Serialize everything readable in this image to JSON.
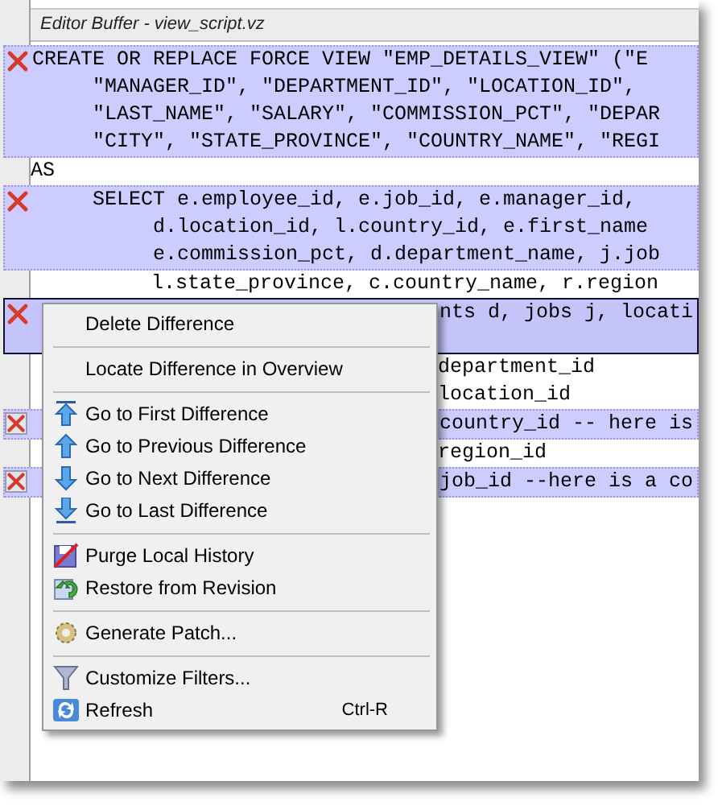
{
  "panel": {
    "title": "Editor Buffer - view_script.vz"
  },
  "blocks": [
    {
      "kind": "diff",
      "selected": false,
      "lines": [
        {
          "text": "CREATE OR REPLACE FORCE VIEW \"EMP_DETAILS_VIEW\" (\"E",
          "covered": false
        },
        {
          "text": "     \"MANAGER_ID\", \"DEPARTMENT_ID\", \"LOCATION_ID\",",
          "covered": false
        },
        {
          "text": "     \"LAST_NAME\", \"SALARY\", \"COMMISSION_PCT\", \"DEPAR",
          "covered": false
        },
        {
          "text": "     \"CITY\", \"STATE_PROVINCE\", \"COUNTRY_NAME\", \"REGI",
          "covered": false
        }
      ]
    },
    {
      "kind": "plain",
      "lines": [
        {
          "text": "AS",
          "covered": false
        }
      ]
    },
    {
      "kind": "diff",
      "selected": false,
      "lines": [
        {
          "text": "     SELECT e.employee_id, e.job_id, e.manager_id,",
          "covered": false
        },
        {
          "text": "          d.location_id, l.country_id, e.first_name",
          "covered": false
        },
        {
          "text": "          e.commission_pct, d.department_name, j.job",
          "covered": false
        }
      ]
    },
    {
      "kind": "plain",
      "lines": [
        {
          "text": "          l.state_province, c.country_name, r.region",
          "covered": false
        }
      ]
    },
    {
      "kind": "diff",
      "selected": true,
      "lines": [
        {
          "text": "nts d, jobs j, locati",
          "covered": true
        }
      ]
    },
    {
      "kind": "plain",
      "lines": [
        {
          "text": "department_id",
          "covered": true
        },
        {
          "text": "location_id",
          "covered": true
        }
      ]
    },
    {
      "kind": "diff",
      "selected": false,
      "lines": [
        {
          "text": "country_id -- here is",
          "covered": true
        }
      ]
    },
    {
      "kind": "plain",
      "lines": [
        {
          "text": "region_id",
          "covered": true
        }
      ]
    },
    {
      "kind": "diff",
      "selected": false,
      "lines": [
        {
          "text": "job_id --here is a co",
          "covered": true
        }
      ]
    }
  ],
  "context_menu": [
    {
      "kind": "item",
      "label": "Delete Difference"
    },
    {
      "kind": "separator"
    },
    {
      "kind": "item",
      "label": "Locate Difference in Overview"
    },
    {
      "kind": "separator"
    },
    {
      "kind": "item",
      "label": "Go to First Difference"
    },
    {
      "kind": "item",
      "label": "Go to Previous Difference"
    },
    {
      "kind": "item",
      "label": "Go to Next Difference"
    },
    {
      "kind": "item",
      "label": "Go to Last Difference"
    },
    {
      "kind": "separator"
    },
    {
      "kind": "item",
      "label": "Purge Local History"
    },
    {
      "kind": "item",
      "label": "Restore from Revision"
    },
    {
      "kind": "separator"
    },
    {
      "kind": "item",
      "label": "Generate Patch..."
    },
    {
      "kind": "separator"
    },
    {
      "kind": "item",
      "label": "Customize Filters..."
    },
    {
      "kind": "item",
      "label": "Refresh",
      "shortcut": "Ctrl-R"
    }
  ]
}
